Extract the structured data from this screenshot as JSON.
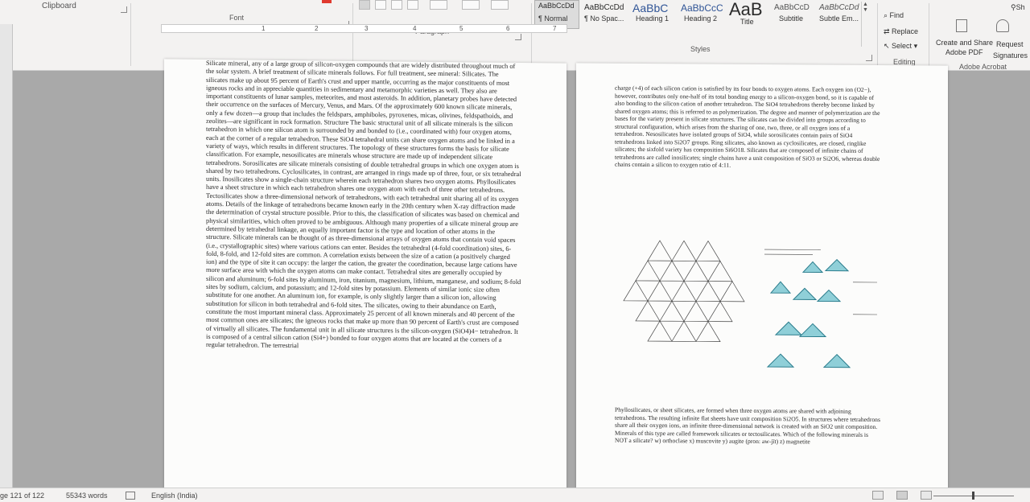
{
  "ribbon": {
    "clipboard_label": "Clipboard",
    "font_label": "Font",
    "paragraph_label": "Paragraph",
    "styles_label": "Styles",
    "editing_label": "Editing",
    "adobe_label": "Adobe Acrobat",
    "styles": [
      {
        "sample": "AaBbCcDd",
        "name": "¶ Normal"
      },
      {
        "sample": "AaBbCcDd",
        "name": "¶ No Spac..."
      },
      {
        "sample": "AaBbC",
        "name": "Heading 1"
      },
      {
        "sample": "AaBbCcC",
        "name": "Heading 2"
      },
      {
        "sample": "AaB",
        "name": "Title"
      },
      {
        "sample": "AaBbCcD",
        "name": "Subtitle"
      },
      {
        "sample": "AaBbCcDd",
        "name": "Subtle Em..."
      }
    ],
    "style_cut": "AaBbCcDd",
    "find": "Find",
    "replace": "Replace",
    "select": "Select",
    "create_share": "Create and Share",
    "adobe_pdf": "Adobe PDF",
    "request": "Request",
    "signatures": "Signatures",
    "share_cut": "Sh"
  },
  "ruler": {
    "marks": [
      "1",
      "2",
      "3",
      "4",
      "5",
      "6",
      "7"
    ]
  },
  "page1": {
    "text": "Silicate mineral, any of a large group of silicon-oxygen compounds that are widely distributed throughout much of the solar system. A brief treatment of silicate minerals follows. For full treatment, see mineral: Silicates. The silicates make up about 95 percent of Earth's crust and upper mantle, occurring as the major constituents of most igneous rocks and in appreciable quantities in sedimentary and metamorphic varieties as well. They also are important constituents of lunar samples, meteorites, and most asteroids. In addition, planetary probes have detected their occurrence on the surfaces of Mercury, Venus, and Mars. Of the approximately 600 known silicate minerals, only a few dozen—a group that includes the feldspars, amphiboles, pyroxenes, micas, olivines, feldspathoids, and zeolites—are significant in rock formation. Structure The basic structural unit of all silicate minerals is the silicon tetrahedron in which one silicon atom is surrounded by and bonded to (i.e., coordinated with) four oxygen atoms, each at the corner of a regular tetrahedron. These SiO4 tetrahedral units can share oxygen atoms and be linked in a variety of ways, which results in different structures. The topology of these structures forms the basis for silicate classification. For example, nesosilicates are minerals whose structure are made up of independent silicate tetrahedrons. Sorosilicates are silicate minerals consisting of double tetrahedral groups in which one oxygen atom is shared by two tetrahedrons. Cyclosilicates, in contrast, are arranged in rings made up of three, four, or six tetrahedral units. Inosilicates show a single-chain structure wherein each tetrahedron shares two oxygen atoms. Phyllosilicates have a sheet structure in which each tetrahedron shares one oxygen atom with each of three other tetrahedrons. Tectosilicates show a three-dimensional network of tetrahedrons, with each tetrahedral unit sharing all of its oxygen atoms. Details of the linkage of tetrahedrons became known early in the 20th century when X-ray diffraction made the determination of crystal structure possible. Prior to this, the classification of silicates was based on chemical and physical similarities, which often proved to be ambiguous. Although many properties of a silicate mineral group are determined by tetrahedral linkage, an equally important factor is the type and location of other atoms in the structure. Silicate minerals can be thought of as three-dimensional arrays of oxygen atoms that contain void spaces (i.e., crystallographic sites) where various cations can enter. Besides the tetrahedral (4-fold coordination) sites, 6-fold, 8-fold, and 12-fold sites are common. A correlation exists between the size of a cation (a positively charged ion) and the type of site it can occupy: the larger the cation, the greater the coordination, because large cations have more surface area with which the oxygen atoms can make contact. Tetrahedral sites are generally occupied by silicon and aluminum; 6-fold sites by aluminum, iron, titanium, magnesium, lithium, manganese, and sodium; 8-fold sites by sodium, calcium, and potassium; and 12-fold sites by potassium. Elements of similar ionic size often substitute for one another. An aluminum ion, for example, is only slightly larger than a silicon ion, allowing substitution for silicon in both tetrahedral and 6-fold sites. The silicates, owing to their abundance on Earth, constitute the most important mineral class. Approximately 25 percent of all known minerals and 40 percent of the most common ones are silicates; the igneous rocks that make up more than 90 percent of Earth's crust are composed of virtually all silicates. The fundamental unit in all silicate structures is the silicon-oxygen (SiO4)4− tetrahedron. It is composed of a central silicon cation (Si4+) bonded to four oxygen atoms that are located at the corners of a regular tetrahedron. The terrestrial"
  },
  "page2": {
    "text_top": "charge (+4) of each silicon cation is satisfied by its four bonds to oxygen atoms. Each oxygen ion (O2−), however, contributes only one-half of its total bonding energy to a silicon-oxygen bond, so it is capable of also bonding to the silicon cation of another tetrahedron. The SiO4 tetrahedrons thereby become linked by shared oxygen atoms; this is referred to as polymerization. The degree and manner of polymerization are the bases for the variety present in silicate structures. The silicates can be divided into groups according to structural configuration, which arises from the sharing of one, two, three, or all oxygen ions of a tetrahedron. Nesosilicates have isolated groups of SiO4, while sorosilicates contain pairs of SiO4 tetrahedrons linked into Si2O7 groups. Ring silicates, also known as cyclosilicates, are closed, ringlike silicates; the sixfold variety has composition Si6O18. Silicates that are composed of infinite chains of tetrahedrons are called inosilicates; single chains have a unit composition of SiO3 or Si2O6, whereas double chains contain a silicon to oxygen ratio of 4:11.",
    "text_bottom": "Phyllosilicates, or sheet silicates, are formed when three oxygen atoms are shared with adjoining tetrahedrons. The resulting infinite flat sheets have unit composition Si2O5. In structures where tetrahedrons share all their oxygen ions, an infinite three-dimensional network is created with an SiO2 unit composition. Minerals of this type are called framework silicates or tectosilicates. Which of the following minerals is NOT a silicate? w) orthoclase x) muscovite y) augite (pron: aw-jīt) z) magnetite"
  },
  "status": {
    "page": "ge 121 of 122",
    "words": "55343 words",
    "language": "English (India)"
  },
  "colors": {
    "accent": "#2b579a",
    "link_underline": "#c00000"
  }
}
